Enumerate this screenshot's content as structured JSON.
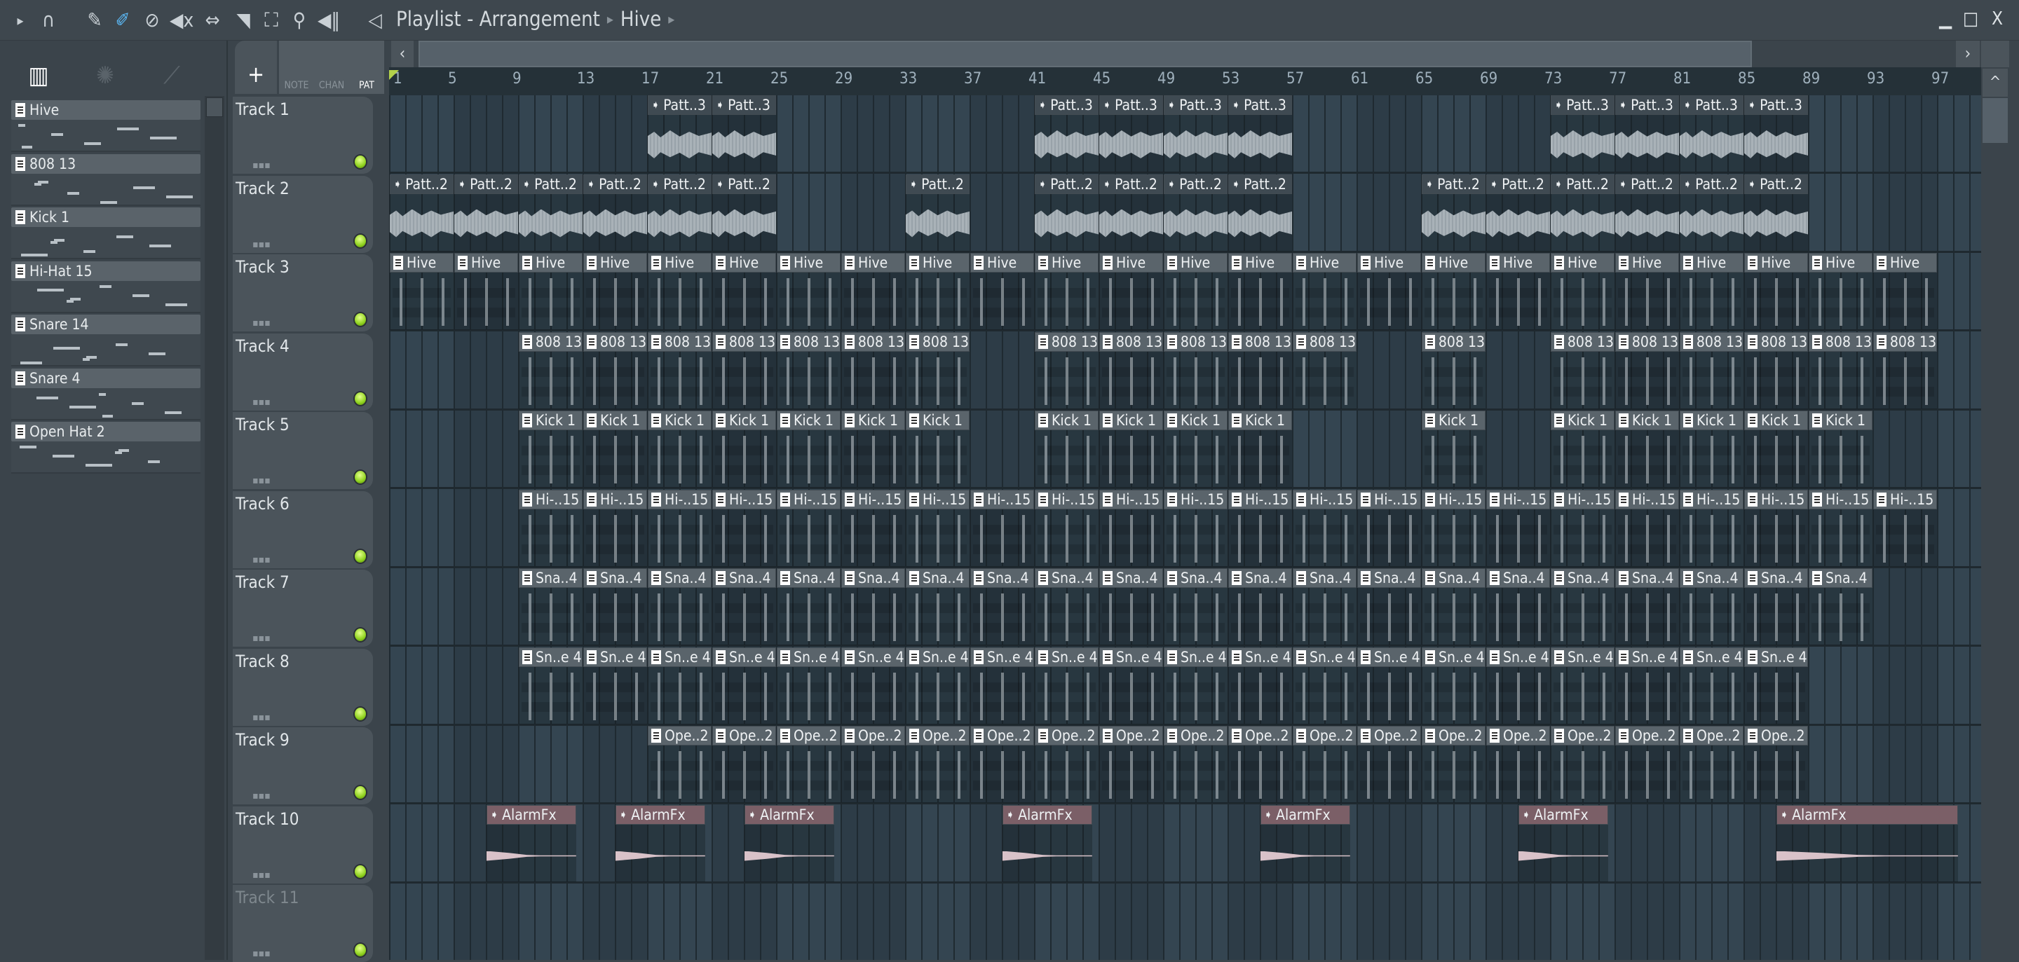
{
  "toolbar": {
    "icons": [
      "play-arrow-icon",
      "magnet-icon",
      "pencil-icon",
      "paint-icon",
      "delete-icon",
      "mute-icon",
      "slip-icon",
      "slice-icon",
      "select-icon",
      "zoom-icon",
      "playback-icon"
    ]
  },
  "title": {
    "app": "Playlist - Arrangement",
    "separator": "▸",
    "pattern": "Hive"
  },
  "window": {
    "minimize": "▁",
    "maximize": "□",
    "close": "X"
  },
  "plist": {
    "add": "+",
    "modes": [
      "NOTE",
      "CHAN",
      "PAT"
    ]
  },
  "patterns": [
    {
      "name": "Hive"
    },
    {
      "name": "808 13"
    },
    {
      "name": "Kick 1"
    },
    {
      "name": "Hi-Hat 15"
    },
    {
      "name": "Snare 14"
    },
    {
      "name": "Snare 4"
    },
    {
      "name": "Open Hat 2"
    }
  ],
  "ruler": [
    "1",
    "5",
    "9",
    "13",
    "17",
    "21",
    "25",
    "29",
    "33",
    "37",
    "41",
    "45",
    "49",
    "53",
    "57",
    "61",
    "65",
    "69",
    "73",
    "77",
    "81",
    "85",
    "89",
    "93",
    "97"
  ],
  "tracks": [
    {
      "name": "Track 1",
      "clips": [
        {
          "label": "Patt..3",
          "type": "audio",
          "bars": [
            17,
            21,
            41,
            45,
            49,
            53,
            73,
            77,
            81,
            85
          ],
          "len": 4
        }
      ]
    },
    {
      "name": "Track 2",
      "clips": [
        {
          "label": "Patt..2",
          "type": "audio",
          "bars": [
            1,
            5,
            9,
            13,
            17,
            21,
            33,
            41,
            45,
            49,
            53,
            65,
            69,
            73,
            77,
            81,
            85
          ],
          "len": 4
        }
      ]
    },
    {
      "name": "Track 3",
      "clips": [
        {
          "label": "Hive",
          "type": "pattern",
          "bars": [
            1,
            5,
            9,
            13,
            17,
            21,
            25,
            29,
            33,
            37,
            41,
            45,
            49,
            53,
            57,
            61,
            65,
            69,
            73,
            77,
            81,
            85,
            89,
            93
          ],
          "len": 4
        }
      ]
    },
    {
      "name": "Track 4",
      "clips": [
        {
          "label": "808 13",
          "type": "pattern",
          "bars": [
            9,
            13,
            17,
            21,
            25,
            29,
            33,
            41,
            45,
            49,
            53,
            57,
            65,
            73,
            77,
            81,
            85,
            89,
            93
          ],
          "len": 4
        }
      ]
    },
    {
      "name": "Track 5",
      "clips": [
        {
          "label": "Kick 1",
          "type": "pattern",
          "bars": [
            9,
            13,
            17,
            21,
            25,
            29,
            33,
            41,
            45,
            49,
            53,
            65,
            73,
            77,
            81,
            85,
            89
          ],
          "len": 4
        }
      ]
    },
    {
      "name": "Track 6",
      "clips": [
        {
          "label": "Hi-..15",
          "type": "pattern",
          "bars": [
            9,
            13,
            17,
            21,
            25,
            29,
            33,
            37,
            41,
            45,
            49,
            53,
            57,
            61,
            65,
            69,
            73,
            77,
            81,
            85,
            89,
            93
          ],
          "len": 4
        }
      ]
    },
    {
      "name": "Track 7",
      "clips": [
        {
          "label": "Sna..4",
          "type": "pattern",
          "bars": [
            9,
            13,
            17,
            21,
            25,
            29,
            33,
            37,
            41,
            45,
            49,
            53,
            57,
            61,
            65,
            69,
            73,
            77,
            81,
            85,
            89
          ],
          "len": 4
        }
      ]
    },
    {
      "name": "Track 8",
      "clips": [
        {
          "label": "Sn..e 4",
          "type": "pattern",
          "bars": [
            9,
            13,
            17,
            21,
            25,
            29,
            33,
            37,
            41,
            45,
            49,
            53,
            57,
            61,
            65,
            69,
            73,
            77,
            81,
            85
          ],
          "len": 4
        }
      ]
    },
    {
      "name": "Track 9",
      "clips": [
        {
          "label": "Ope..2",
          "type": "pattern",
          "bars": [
            17,
            21,
            25,
            29,
            33,
            37,
            41,
            45,
            49,
            53,
            57,
            61,
            65,
            69,
            73,
            77,
            81,
            85
          ],
          "len": 4
        }
      ]
    },
    {
      "name": "Track 10",
      "clips": [
        {
          "label": "AlarmFx",
          "type": "fx",
          "bars": [
            7,
            15,
            23,
            39,
            55,
            71
          ],
          "len": 5.6
        },
        {
          "label": "AlarmFx",
          "type": "fx",
          "bars": [
            87
          ],
          "len": 11.3
        }
      ]
    },
    {
      "name": "Track 11",
      "dim": true,
      "clips": []
    }
  ],
  "colors": {
    "accent": "#5bb8f5",
    "led": "#8fd21e",
    "fx_clip": "#7b5f67"
  }
}
